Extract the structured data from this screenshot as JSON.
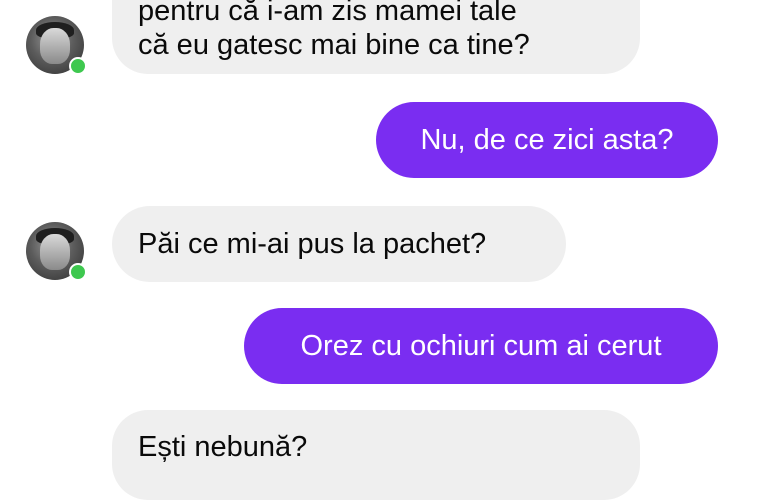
{
  "messages": [
    {
      "sender": "contact",
      "lines": [
        "pentru că i-am zis mamei tale",
        "că eu gatesc mai bine ca tine?"
      ]
    },
    {
      "sender": "me",
      "text": "Nu, de ce zici asta?"
    },
    {
      "sender": "contact",
      "text": "Păi ce mi-ai pus la pachet?"
    },
    {
      "sender": "me",
      "text": "Orez cu ochiuri cum ai cerut"
    },
    {
      "sender": "contact",
      "text": "Ești nebună?"
    }
  ],
  "colors": {
    "outgoing_bubble": "#7a2df1",
    "incoming_bubble": "#efefef",
    "online_dot": "#3ec84f"
  },
  "icons": {
    "avatar": "contact-avatar",
    "presence": "online-status-dot"
  }
}
